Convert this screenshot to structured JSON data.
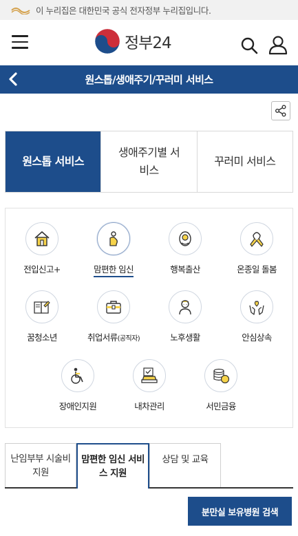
{
  "gov_notice": "이 누리집은 대한민국 공식 전자정부 누리집입니다.",
  "brand": {
    "name": "정부24",
    "primary_color": "#1d4d8b"
  },
  "page_title": "원스톱/생애주기/꾸러미 서비스",
  "main_tabs": [
    {
      "label": "원스톱 서비스",
      "active": true
    },
    {
      "label": "생애주기별 서비스",
      "active": false
    },
    {
      "label": "꾸러미 서비스",
      "active": false
    }
  ],
  "services": [
    {
      "label": "전입신고+",
      "icon": "house-icon"
    },
    {
      "label": "맘편한 임신",
      "icon": "pregnant-icon",
      "selected": true
    },
    {
      "label": "행복출산",
      "icon": "baby-icon"
    },
    {
      "label": "온종일 돌봄",
      "icon": "ribbon-icon"
    },
    {
      "label": "꿈청소년",
      "icon": "book-icon"
    },
    {
      "label": "취업서류",
      "label_small": "(공직자)",
      "icon": "briefcase-icon"
    },
    {
      "label": "노후생활",
      "icon": "elder-icon"
    },
    {
      "label": "안심상속",
      "icon": "hands-heart-icon"
    },
    {
      "label": "장애인지원",
      "icon": "wheelchair-icon"
    },
    {
      "label": "내차관리",
      "icon": "car-check-icon"
    },
    {
      "label": "서민금융",
      "icon": "coins-icon"
    }
  ],
  "sub_tabs": [
    {
      "label": "난임부부 시술비 지원",
      "active": false
    },
    {
      "label": "맘편한 임신 서비스 지원",
      "active": true
    },
    {
      "label": "상담 및 교육",
      "active": false
    }
  ],
  "cta_label": "분만실 보유병원 검색"
}
